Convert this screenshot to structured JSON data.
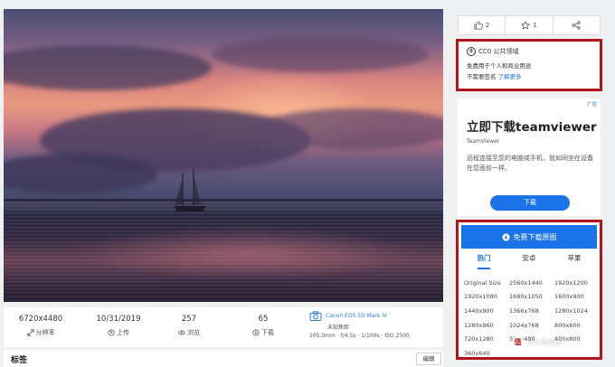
{
  "stats": [
    {
      "value": "6720x4480",
      "label": "分辨率",
      "icon": "resize-icon"
    },
    {
      "value": "10/31/2019",
      "label": "上传",
      "icon": "upload-icon"
    },
    {
      "value": "257",
      "label": "浏览",
      "icon": "eye-icon"
    },
    {
      "value": "65",
      "label": "下载",
      "icon": "download-icon"
    }
  ],
  "camera": {
    "name": "Canon EOS 5D Mark IV",
    "lens": "未知焦距",
    "exif": "105.0mm · f/4.5s · 1/100s · ISO 2500"
  },
  "tags": {
    "title": "标签",
    "edit_label": "编辑"
  },
  "actions": {
    "like_count": "2",
    "collect_count": "1"
  },
  "license": {
    "name": "CC0 公共领域",
    "line1": "免费用于个人和商业用途",
    "line2": "不需要签名",
    "link": "了解更多"
  },
  "ad": {
    "mark": "广告",
    "title": "立即下载teamviewer",
    "brand": "TeamViewer",
    "desc": "远程连接至您的电脑或手机，就如同坐在设备在您面前一样。",
    "button": "下载"
  },
  "download": {
    "title": "免费下载原图",
    "tabs": [
      "热门",
      "安卓",
      "苹果"
    ],
    "active_tab": 0,
    "rows": [
      [
        "Original Size",
        "2560x1440",
        "1920x1200"
      ],
      [
        "1920x1080",
        "1680x1050",
        "1600x900"
      ],
      [
        "1440x900",
        "1366x768",
        "1280x1024"
      ],
      [
        "1280x960",
        "1024x768",
        "800x600"
      ],
      [
        "720x1280",
        "320x480",
        "480x800"
      ],
      [
        "360x640",
        "",
        ""
      ]
    ]
  },
  "watermark": {
    "text": "什么值得买",
    "badge": "值"
  },
  "colors": {
    "accent": "#1a73e8",
    "highlight_border": "#b3131a"
  }
}
